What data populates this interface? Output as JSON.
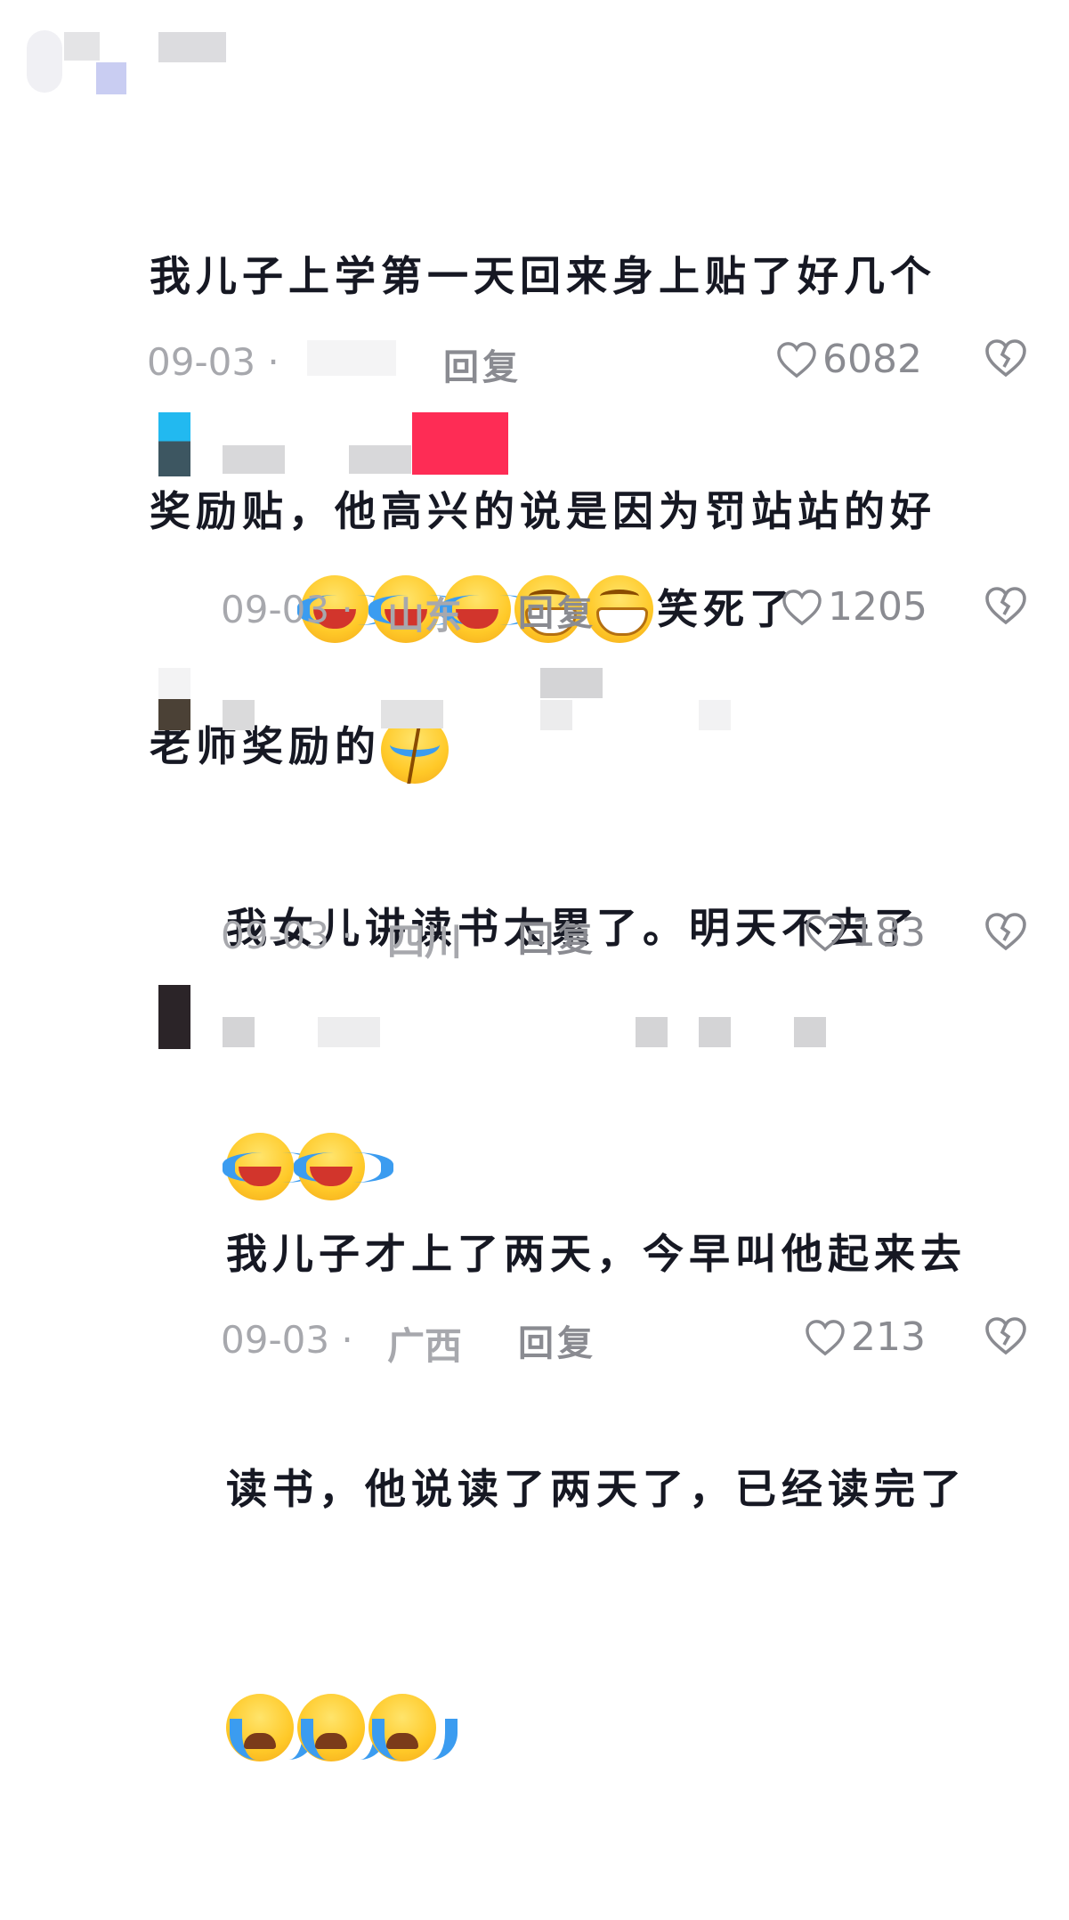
{
  "comments": [
    {
      "text_lines": [
        "我儿子上学第一天回来身上贴了好几个",
        "奖励贴，他高兴的说是因为罚站站的好",
        "老师奖励的"
      ],
      "emoji": [
        "broken"
      ],
      "date": "09-03 ·",
      "region": "",
      "reply": "回复",
      "likes": "6082"
    },
    {
      "emoji": [
        "crying-laugh",
        "crying-laugh",
        "crying-laugh",
        "grin",
        "grin"
      ],
      "text": "笑死了",
      "date": "09-03 ·",
      "region": "山东",
      "reply": "回复",
      "likes": "1205"
    },
    {
      "text_lines": [
        "我女儿讲读书太累了。明天不去了"
      ],
      "emoji": [
        "crying-laugh",
        "crying-laugh"
      ],
      "date": "09-03 ·",
      "region": "四川",
      "reply": "回复",
      "likes": "183"
    },
    {
      "text_lines": [
        "我儿子才上了两天，今早叫他起来去",
        "读书，他说读了两天了，已经读完了"
      ],
      "emoji": [
        "sob",
        "sob",
        "sob"
      ],
      "date": "09-03 ·",
      "region": "广西",
      "reply": "回复",
      "likes": "213"
    }
  ],
  "colors": {
    "text": "#161823",
    "meta": "#a7a8ad",
    "icon": "#8a8b91",
    "badge": "#fe2c55"
  },
  "icons": {
    "like": "heart-outline-icon",
    "dislike": "broken-heart-icon"
  }
}
